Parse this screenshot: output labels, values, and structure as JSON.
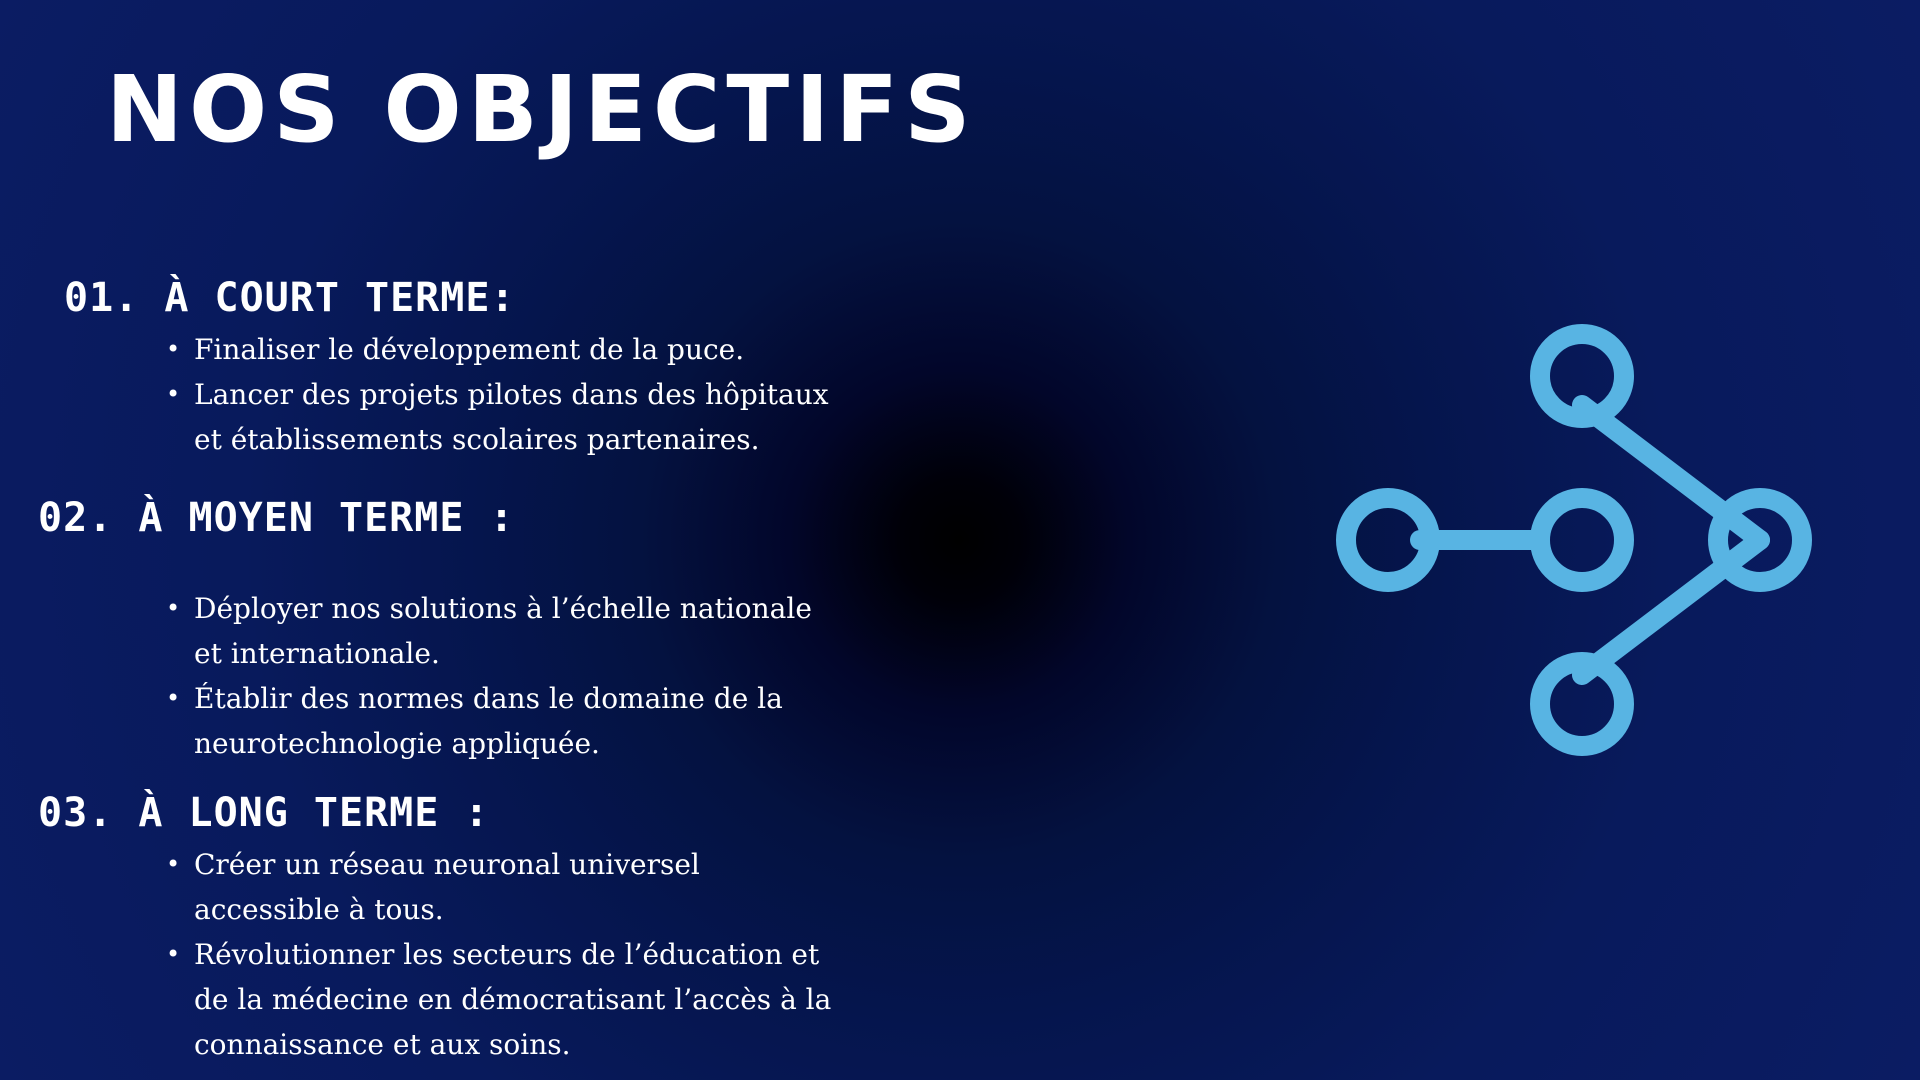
{
  "slide": {
    "title": "NOS OBJECTIFS",
    "accent_color": "#58b4e3",
    "icon": "flow-diagram-icon",
    "sections": [
      {
        "heading": "01. À court terme:",
        "bullets": [
          "Finaliser le développement de la puce.",
          "Lancer des projets pilotes dans des hôpitaux et établissements scolaires partenaires."
        ]
      },
      {
        "heading": "02. À moyen terme :",
        "bullets": [
          "Déployer nos solutions à l’échelle nationale et internationale.",
          "Établir des normes dans le domaine de la neurotechnologie appliquée."
        ]
      },
      {
        "heading": "03. À long terme :",
        "bullets": [
          "Créer un réseau neuronal universel accessible à tous.",
          "Révolutionner les secteurs de l’éducation et de la médecine en démocratisant l’accès à la connaissance et aux soins."
        ]
      }
    ]
  }
}
